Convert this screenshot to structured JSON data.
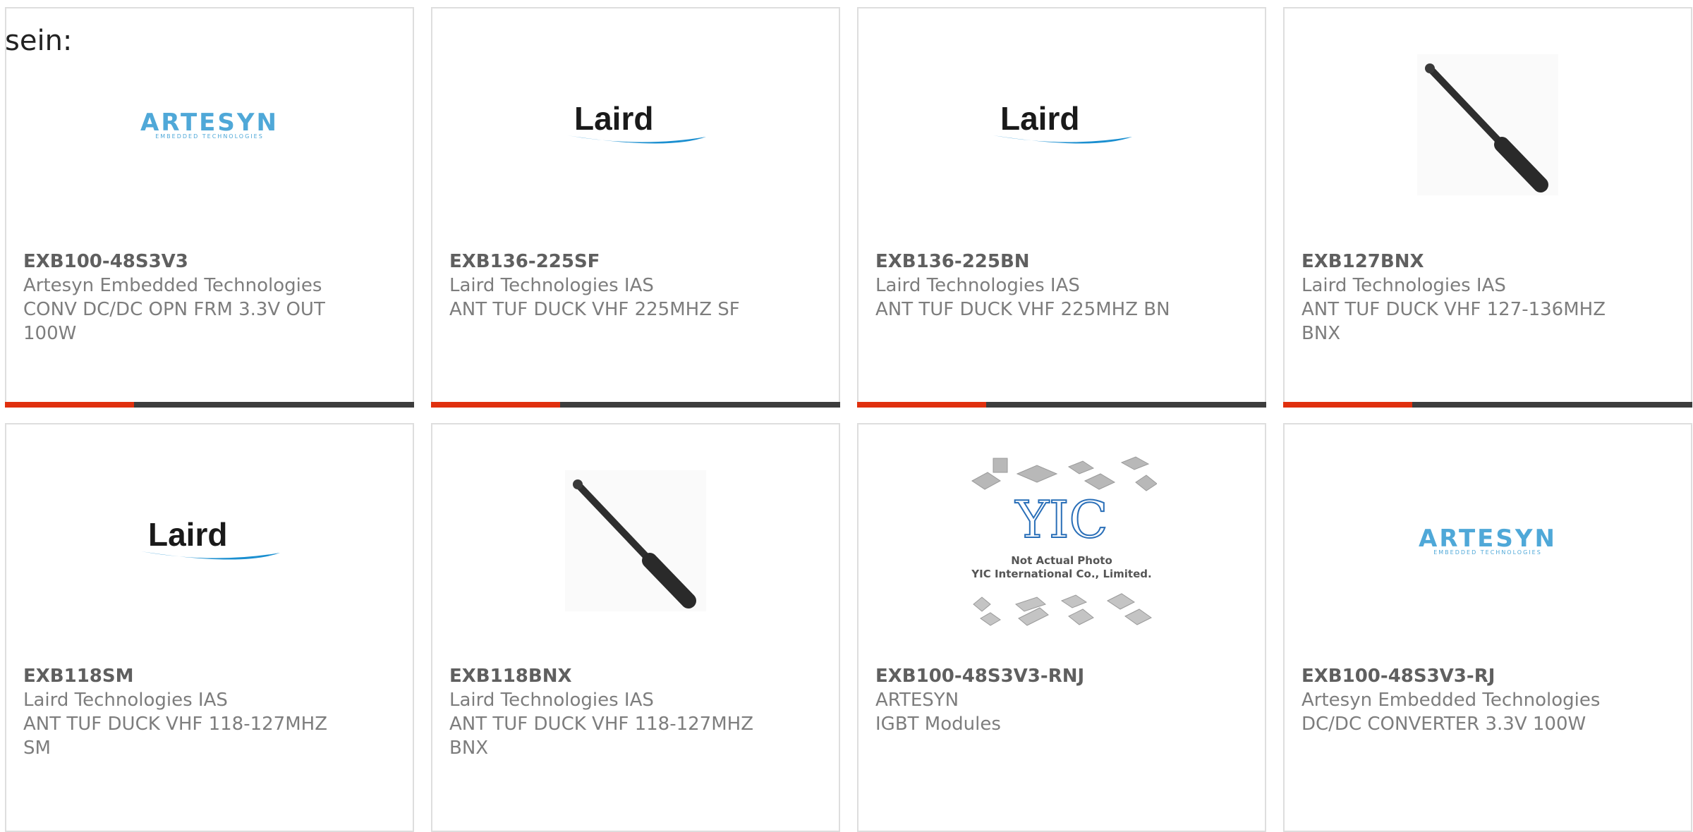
{
  "intro_text": "sein:",
  "products": [
    {
      "part_number": "EXB100-48S3V3",
      "manufacturer": "Artesyn Embedded Technologies",
      "description": "CONV DC/DC OPN FRM 3.3V OUT 100W",
      "image": "artesyn-logo",
      "logo_text": "ARTESYN",
      "logo_subtext": "EMBEDDED TECHNOLOGIES"
    },
    {
      "part_number": "EXB136-225SF",
      "manufacturer": "Laird Technologies IAS",
      "description": "ANT TUF DUCK VHF 225MHZ SF",
      "image": "laird-logo",
      "logo_text": "Laird"
    },
    {
      "part_number": "EXB136-225BN",
      "manufacturer": "Laird Technologies IAS",
      "description": "ANT TUF DUCK VHF 225MHZ BN",
      "image": "laird-logo",
      "logo_text": "Laird"
    },
    {
      "part_number": "EXB127BNX",
      "manufacturer": "Laird Technologies IAS",
      "description": "ANT TUF DUCK VHF 127-136MHZ BNX",
      "image": "antenna-photo"
    },
    {
      "part_number": "EXB118SM",
      "manufacturer": "Laird Technologies IAS",
      "description": "ANT TUF DUCK VHF 118-127MHZ SM",
      "image": "laird-logo",
      "logo_text": "Laird"
    },
    {
      "part_number": "EXB118BNX",
      "manufacturer": "Laird Technologies IAS",
      "description": "ANT TUF DUCK VHF 118-127MHZ BNX",
      "image": "antenna-photo"
    },
    {
      "part_number": "EXB100-48S3V3-RNJ",
      "manufacturer": "ARTESYN",
      "description": "IGBT Modules",
      "image": "placeholder-chips",
      "placeholder_line1": "Not Actual Photo",
      "placeholder_line2": "YIC International Co., Limited.",
      "logo_text": "YIC"
    },
    {
      "part_number": "EXB100-48S3V3-RJ",
      "manufacturer": "Artesyn Embedded Technologies",
      "description": "DC/DC CONVERTER 3.3V 100W",
      "image": "artesyn-logo",
      "logo_text": "ARTESYN",
      "logo_subtext": "EMBEDDED TECHNOLOGIES"
    }
  ],
  "colors": {
    "accent": "#e0300e",
    "bar": "#3d3d3d",
    "border": "#dedede",
    "laird_blue": "#1b8fd0",
    "artesyn_blue": "#4fa8d8"
  }
}
